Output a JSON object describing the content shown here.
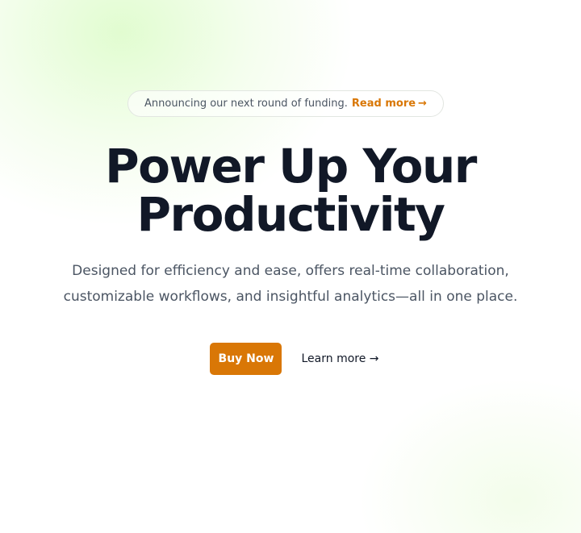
{
  "announcement": {
    "text": "Announcing our next round of funding.",
    "link_label": "Read more",
    "arrow": "→"
  },
  "hero": {
    "headline": "Power Up Your Productivity",
    "subtitle": "Designed for efficiency and ease, offers real-time collaboration, customizable workflows, and insightful analytics—all in one place."
  },
  "actions": {
    "primary_label": "Buy Now",
    "secondary_label": "Learn more",
    "secondary_arrow": "→"
  },
  "colors": {
    "accent": "#d97706",
    "heading": "#111827",
    "body_text": "#4b5563"
  }
}
